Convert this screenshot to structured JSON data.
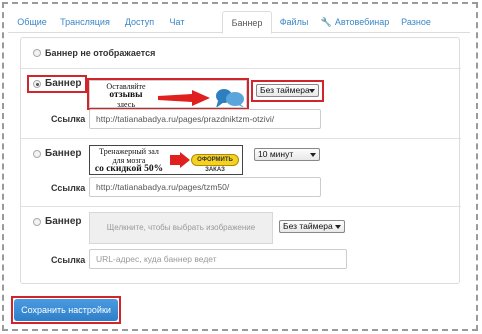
{
  "tabs": [
    {
      "label": "Общие"
    },
    {
      "label": "Трансляция"
    },
    {
      "label": "Доступ"
    },
    {
      "label": "Чат"
    },
    {
      "label": "Баннер",
      "active": true
    },
    {
      "label": "Файлы"
    },
    {
      "label": "Автовебинар",
      "icon": "wrench-icon"
    },
    {
      "label": "Разное"
    }
  ],
  "banners": {
    "none_label": "Баннер не отображается",
    "items": [
      {
        "label": "Баннер",
        "checked": true,
        "image_text": [
          "Оставляйте",
          "отзывы",
          "здесь"
        ],
        "timer": "Без таймера",
        "link_label": "Ссылка",
        "link_value": "http://tatianabadya.ru/pages/prazdniktzm-otzivi/"
      },
      {
        "label": "Баннер",
        "checked": false,
        "image_text": [
          "Тренажерный зал",
          "для мозга",
          "со скидкой 50%"
        ],
        "order_button": "ОФОРМИТЬ ЗАКАЗ",
        "timer": "10 минут",
        "link_label": "Ссылка",
        "link_value": "http://tatianabadya.ru/pages/tzm50/"
      },
      {
        "label": "Баннер",
        "checked": false,
        "image_placeholder": "Щелкните, чтобы выбрать изображение",
        "timer": "Без таймера",
        "link_label": "Ссылка",
        "link_placeholder": "URL-адрес, куда баннер ведет"
      }
    ]
  },
  "save_button": "Сохранить настройки",
  "colors": {
    "accent": "#3a86c8",
    "highlight": "#d0262b",
    "button": "#3a8bd4"
  }
}
